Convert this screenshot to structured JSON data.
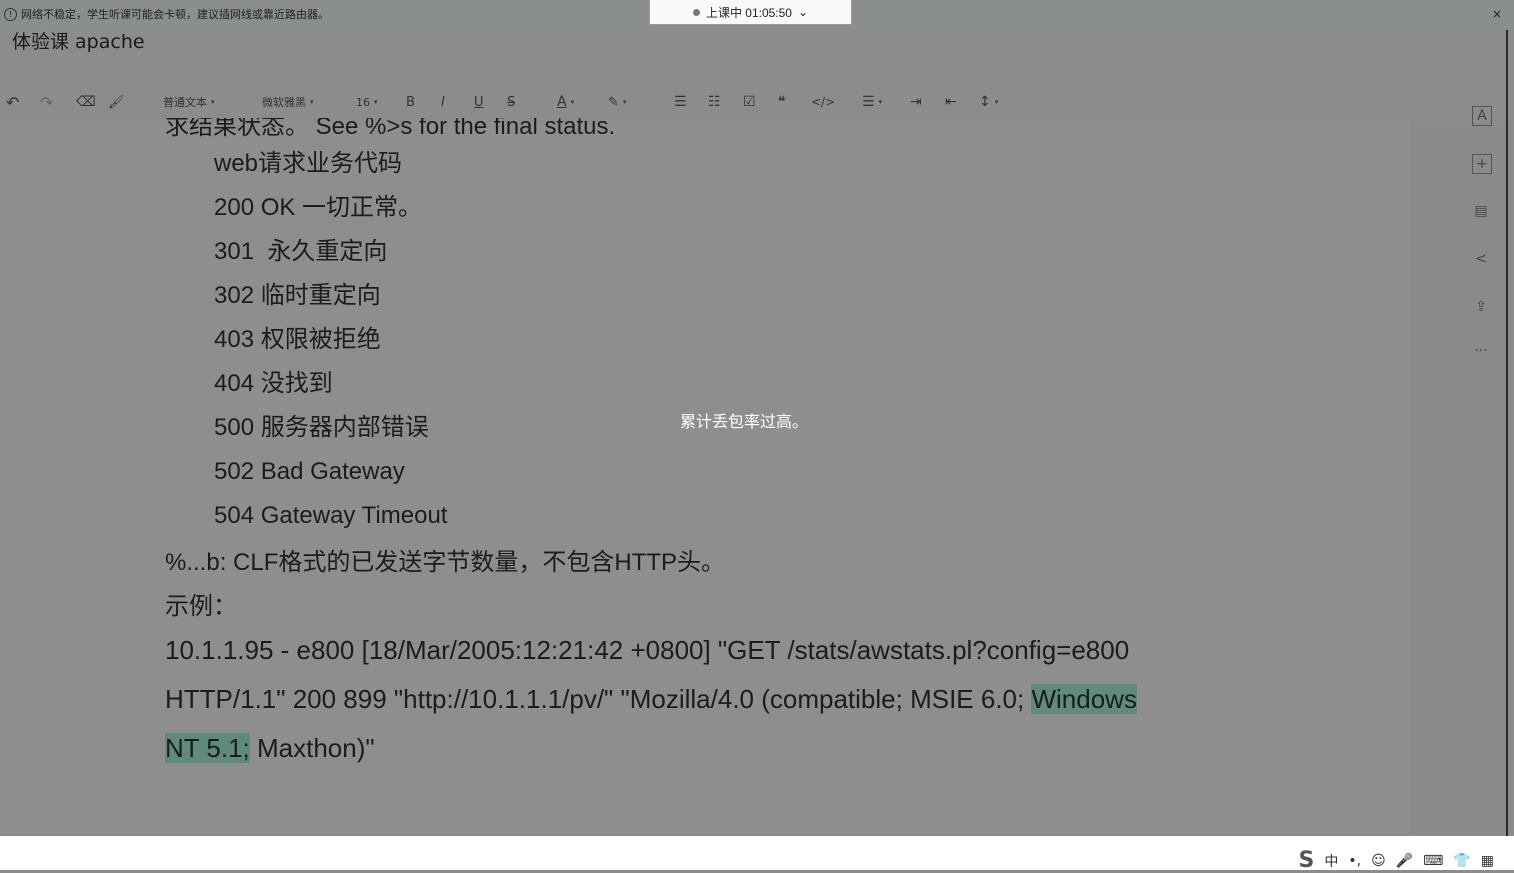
{
  "notice": {
    "text": "网络不稳定，学生听课可能会卡顿，建议插网线或靠近路由器。",
    "close": "×"
  },
  "live_status": {
    "label": "上课中 01:05:50",
    "caret": "⌄"
  },
  "doc": {
    "title": "体验课 apache"
  },
  "toolbar": {
    "undo": "↶",
    "redo": "↷",
    "eraser": "⌫",
    "format_painter": "🖌",
    "paragraph_style": "普通文本",
    "font_family": "微软雅黑",
    "font_size": "16",
    "bold": "B",
    "italic": "I",
    "underline": "U",
    "strike": "S",
    "font_color": "A",
    "highlight": "✎",
    "bullet_list": "☰",
    "ordered_list": "☷",
    "checklist": "☑",
    "quote": "❝",
    "code": "</>",
    "align": "☰",
    "indent": "⇥",
    "outdent": "⇤",
    "line_height": "↕",
    "caret": "▾"
  },
  "rail": {
    "icons": [
      "A",
      "+",
      "▤",
      "<",
      "⇪",
      "···"
    ]
  },
  "content": {
    "cut_line": "求结果状态。 See %>s for the final status.",
    "codes": [
      "web请求业务代码",
      "200 OK 一切正常。",
      "301  永久重定向",
      "302 临时重定向",
      "403 权限被拒绝",
      "404 没找到",
      "500 服务器内部错误",
      "502 Bad Gateway",
      "504 Gateway Timeout"
    ],
    "bytes_line": "%...b: CLF格式的已发送字节数量，不包含HTTP头。",
    "example_label": "示例：",
    "example_line1": "10.1.1.95 - e800 [18/Mar/2005:12:21:42 +0800] \"GET /stats/awstats.pl?config=e800",
    "example_line2_a": "HTTP/1.1\" 200 899 \"http://10.1.1.1/pv/\" \"Mozilla/4.0 (compatible; MSIE 6.0; ",
    "example_line2_hl": "Windows",
    "example_line3_hl": "NT 5.1;",
    "example_line3_b": " Maxthon)\""
  },
  "toast": {
    "text": "累计丢包率过高。"
  },
  "tray": {
    "logo": "S",
    "ime": "中",
    "punct": "•,",
    "emoji": "☺",
    "mic": "🎤",
    "keyboard": "⌨",
    "skin": "👕",
    "apps": "▦"
  }
}
